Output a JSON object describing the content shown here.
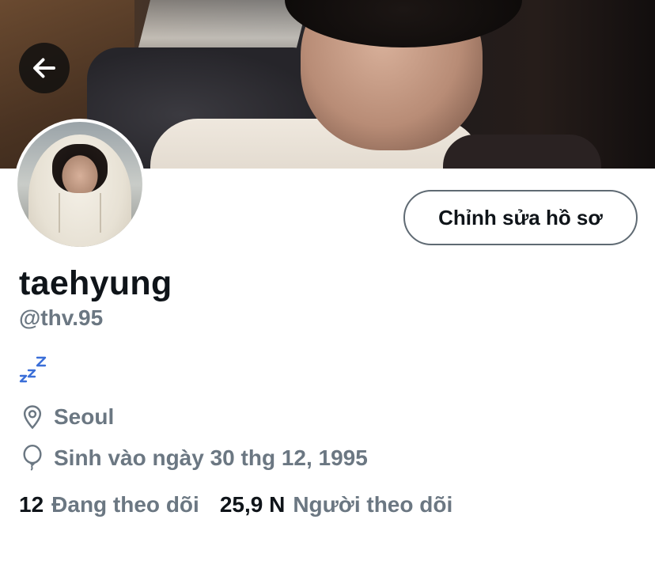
{
  "profile": {
    "display_name": "taehyung",
    "handle": "@thv.95",
    "bio_icon": "zzz-sleeping-emoji",
    "location": "Seoul",
    "birthday": "Sinh vào ngày 30 thg 12, 1995"
  },
  "actions": {
    "edit_profile_label": "Chỉnh sửa hồ sơ",
    "back_icon": "arrow-left-icon"
  },
  "stats": {
    "following_count": "12",
    "following_label": "Đang theo dõi",
    "followers_count": "25,9 N",
    "followers_label": "Người theo dõi"
  },
  "colors": {
    "text_primary": "#0f1419",
    "text_secondary": "#6b7782",
    "zzz_blue": "#3b6fd8",
    "button_border": "#5f6a73"
  }
}
